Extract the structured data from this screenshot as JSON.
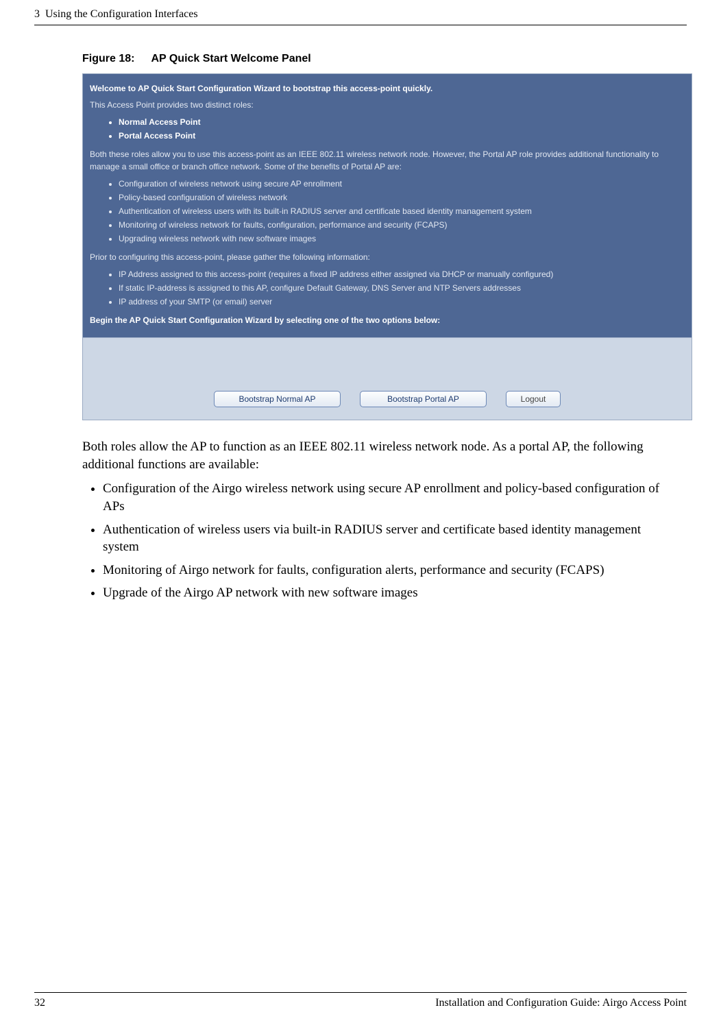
{
  "header": {
    "chapter": "3",
    "chapter_title": "Using the Configuration Interfaces"
  },
  "figure": {
    "label": "Figure 18:",
    "title": "AP Quick Start Welcome Panel"
  },
  "panel": {
    "welcome_bold": "Welcome to AP Quick Start Configuration Wizard to bootstrap this access-point quickly.",
    "roles_intro": "This Access Point provides two distinct roles:",
    "role1": "Normal Access Point",
    "role2": "Portal Access Point",
    "both_roles": "Both these roles allow you to use this access-point as an IEEE 802.11 wireless network node. However, the Portal AP role provides additional functionality to manage a small office or branch office network. Some of the benefits of Portal AP are:",
    "benefits": [
      "Configuration of wireless network using secure AP enrollment",
      "Policy-based configuration of wireless network",
      "Authentication of wireless users with its built-in RADIUS server and certificate based identity management system",
      "Monitoring of wireless network for faults, configuration, performance and security (FCAPS)",
      "Upgrading wireless network with new software images"
    ],
    "gather_intro": "Prior to configuring this access-point, please gather the following information:",
    "gather": [
      "IP Address assigned to this access-point (requires a fixed IP address either assigned via DHCP or manually configured)",
      "If static IP-address is assigned to this AP, configure Default Gateway, DNS Server and NTP Servers addresses",
      "IP address of your SMTP (or email) server"
    ],
    "begin_bold": "Begin the AP Quick Start Configuration Wizard by selecting one of the two options below:",
    "btn_normal": "Bootstrap Normal AP",
    "btn_portal": "Bootstrap Portal AP",
    "btn_logout": "Logout"
  },
  "body": {
    "intro": "Both roles allow the AP to function as an IEEE 802.11 wireless network node. As a portal AP, the following additional functions are available:",
    "items": [
      "Configuration of the Airgo wireless network using secure AP enrollment and policy-based configuration of APs",
      "Authentication of wireless users via built-in RADIUS server and certificate based identity management system",
      "Monitoring of Airgo network for faults, configuration alerts, performance and security (FCAPS)",
      "Upgrade of the Airgo AP network with new software images"
    ]
  },
  "footer": {
    "page": "32",
    "doc_title": "Installation and Configuration Guide: Airgo Access Point"
  }
}
